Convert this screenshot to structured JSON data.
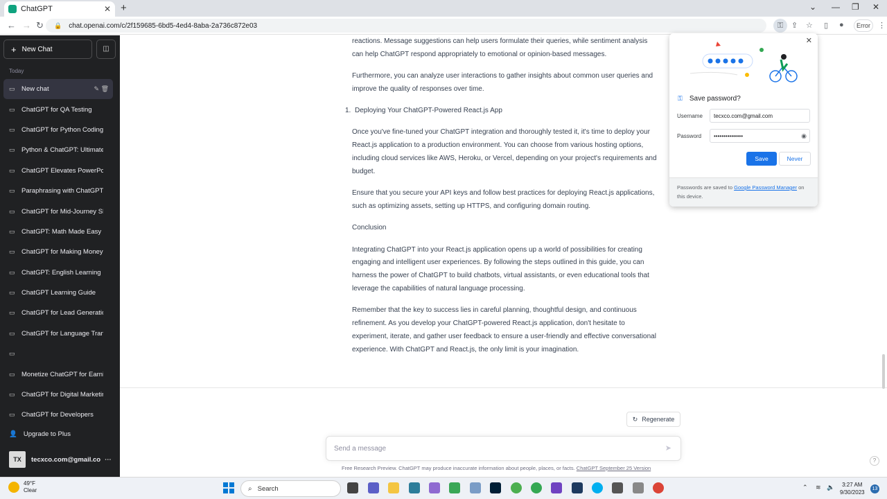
{
  "browser": {
    "tab_title": "ChatGPT",
    "url": "chat.openai.com/c/2f159685-6bd5-4ed4-8aba-2a736c872e03",
    "error_chip": "Error"
  },
  "sidebar": {
    "new_chat_label": "New Chat",
    "section_label": "Today",
    "items": [
      {
        "label": "New chat"
      },
      {
        "label": "ChatGPT for QA Testing"
      },
      {
        "label": "ChatGPT for Python Coding"
      },
      {
        "label": "Python & ChatGPT: Ultimate"
      },
      {
        "label": "ChatGPT Elevates PowerPoin"
      },
      {
        "label": "Paraphrasing with ChatGPT"
      },
      {
        "label": "ChatGPT for Mid-Journey SE"
      },
      {
        "label": "ChatGPT: Math Made Easy"
      },
      {
        "label": "ChatGPT for Making Money"
      },
      {
        "label": "ChatGPT: English Learning R"
      },
      {
        "label": "ChatGPT Learning Guide"
      },
      {
        "label": "ChatGPT for Lead Generatio"
      },
      {
        "label": "ChatGPT for Language Trans"
      },
      {
        "label": ""
      },
      {
        "label": "Monetize ChatGPT for Earnin"
      },
      {
        "label": "ChatGPT for Digital Marketin"
      },
      {
        "label": "ChatGPT for Developers"
      }
    ],
    "upgrade_label": "Upgrade to Plus",
    "account_initials": "TX",
    "account_name": "tecxco.com@gmail.cor"
  },
  "conversation": {
    "p1": "reactions. Message suggestions can help users formulate their queries, while sentiment analysis can help ChatGPT respond appropriately to emotional or opinion-based messages.",
    "p2": "Furthermore, you can analyze user interactions to gather insights about common user queries and improve the quality of responses over time.",
    "list_number": "1.",
    "list_item": "Deploying Your ChatGPT-Powered React.js App",
    "p3": "Once you've fine-tuned your ChatGPT integration and thoroughly tested it, it's time to deploy your React.js application to a production environment. You can choose from various hosting options, including cloud services like AWS, Heroku, or Vercel, depending on your project's requirements and budget.",
    "p4": "Ensure that you secure your API keys and follow best practices for deploying React.js applications, such as optimizing assets, setting up HTTPS, and configuring domain routing.",
    "p5": "Conclusion",
    "p6": "Integrating ChatGPT into your React.js application opens up a world of possibilities for creating engaging and intelligent user experiences. By following the steps outlined in this guide, you can harness the power of ChatGPT to build chatbots, virtual assistants, or even educational tools that leverage the capabilities of natural language processing.",
    "p7": "Remember that the key to success lies in careful planning, thoughtful design, and continuous refinement. As you develop your ChatGPT-powered React.js application, don't hesitate to experiment, iterate, and gather user feedback to ensure a user-friendly and effective conversational experience. With ChatGPT and React.js, the only limit is your imagination."
  },
  "composer": {
    "regenerate_label": "Regenerate",
    "placeholder": "Send a message",
    "footnote": "Free Research Preview. ChatGPT may produce inaccurate information about people, places, or facts.",
    "footnote_link": "ChatGPT September 25 Version",
    "help": "?"
  },
  "password_popup": {
    "title": "Save password?",
    "username_label": "Username",
    "username_value": "tecxco.com@gmail.com",
    "password_label": "Password",
    "password_value": "•••••••••••••••",
    "save_label": "Save",
    "never_label": "Never",
    "footer_pre": "Passwords are saved to",
    "footer_link": "Google Password Manager",
    "footer_post": "on this device."
  },
  "taskbar": {
    "temperature": "49°F",
    "condition": "Clear",
    "search_label": "Search",
    "time": "3:27 AM",
    "date": "9/30/2023",
    "notification_count": "13"
  },
  "colors": {
    "sidebar_bg": "#202123",
    "accent_green": "#10a37f",
    "save_blue": "#1a73e8"
  }
}
